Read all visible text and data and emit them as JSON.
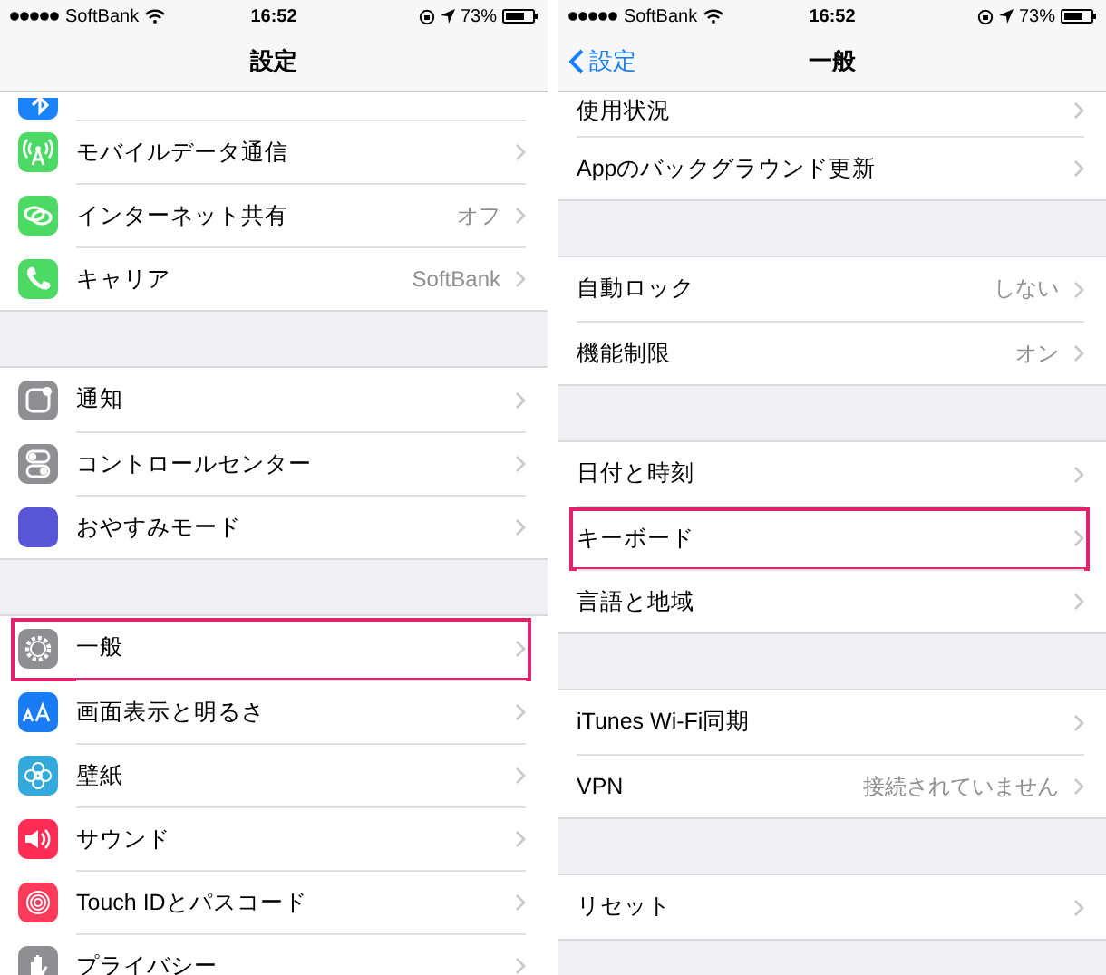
{
  "panels": [
    {
      "status_bar": {
        "carrier": "SoftBank",
        "time": "16:52",
        "battery": "73%"
      },
      "nav": {
        "title": "設定"
      },
      "groups": [
        {
          "rows": [
            {
              "kind": "partial",
              "color": "#1a82fb"
            },
            {
              "kind": "row",
              "label": "モバイルデータ通信",
              "color": "#4cd964",
              "highlighted": false
            },
            {
              "kind": "row",
              "label": "インターネット共有",
              "value": "オフ",
              "color": "#4cd964",
              "highlighted": false
            },
            {
              "kind": "row",
              "label": "キャリア",
              "value": "SoftBank",
              "color": "#4cd964",
              "highlighted": false
            }
          ]
        },
        {
          "rows": [
            {
              "kind": "row",
              "label": "通知",
              "color": "#8e8e93",
              "highlighted": false
            },
            {
              "kind": "row",
              "label": "コントロールセンター",
              "color": "#8e8e93",
              "highlighted": false
            },
            {
              "kind": "row",
              "label": "おやすみモード",
              "color": "#5856d6",
              "highlighted": false
            }
          ]
        },
        {
          "rows": [
            {
              "kind": "row",
              "label": "一般",
              "color": "#8e8e93",
              "highlighted": true
            },
            {
              "kind": "row",
              "label": "画面表示と明るさ",
              "color": "#1a7cf5",
              "highlighted": false
            },
            {
              "kind": "row",
              "label": "壁紙",
              "color": "#34aadc",
              "highlighted": false
            },
            {
              "kind": "row",
              "label": "サウンド",
              "color": "#ff2d55",
              "highlighted": false
            },
            {
              "kind": "row",
              "label": "Touch IDとパスコード",
              "color": "#ff3b5c",
              "highlighted": false
            },
            {
              "kind": "row",
              "label": "プライバシー",
              "color": "#8e8e93",
              "highlighted": false
            }
          ]
        }
      ]
    },
    {
      "status_bar": {
        "carrier": "SoftBank",
        "time": "16:52",
        "battery": "73%"
      },
      "nav": {
        "back": "設定",
        "title": "一般"
      },
      "groups": [
        {
          "rows": [
            {
              "kind": "top",
              "label": "使用状況",
              "highlighted": false
            },
            {
              "kind": "row",
              "label": "Appのバックグラウンド更新",
              "highlighted": false
            }
          ]
        },
        {
          "rows": [
            {
              "kind": "row",
              "label": "自動ロック",
              "value": "しない",
              "highlighted": false
            },
            {
              "kind": "row",
              "label": "機能制限",
              "value": "オン",
              "highlighted": false
            }
          ]
        },
        {
          "rows": [
            {
              "kind": "row",
              "label": "日付と時刻",
              "highlighted": false
            },
            {
              "kind": "row",
              "label": "キーボード",
              "highlighted": true
            },
            {
              "kind": "row",
              "label": "言語と地域",
              "highlighted": false
            }
          ]
        },
        {
          "rows": [
            {
              "kind": "row",
              "label": "iTunes Wi-Fi同期",
              "highlighted": false
            },
            {
              "kind": "row",
              "label": "VPN",
              "value": "接続されていません",
              "highlighted": false
            }
          ]
        },
        {
          "rows": [
            {
              "kind": "row",
              "label": "リセット",
              "highlighted": false
            }
          ]
        }
      ]
    }
  ]
}
